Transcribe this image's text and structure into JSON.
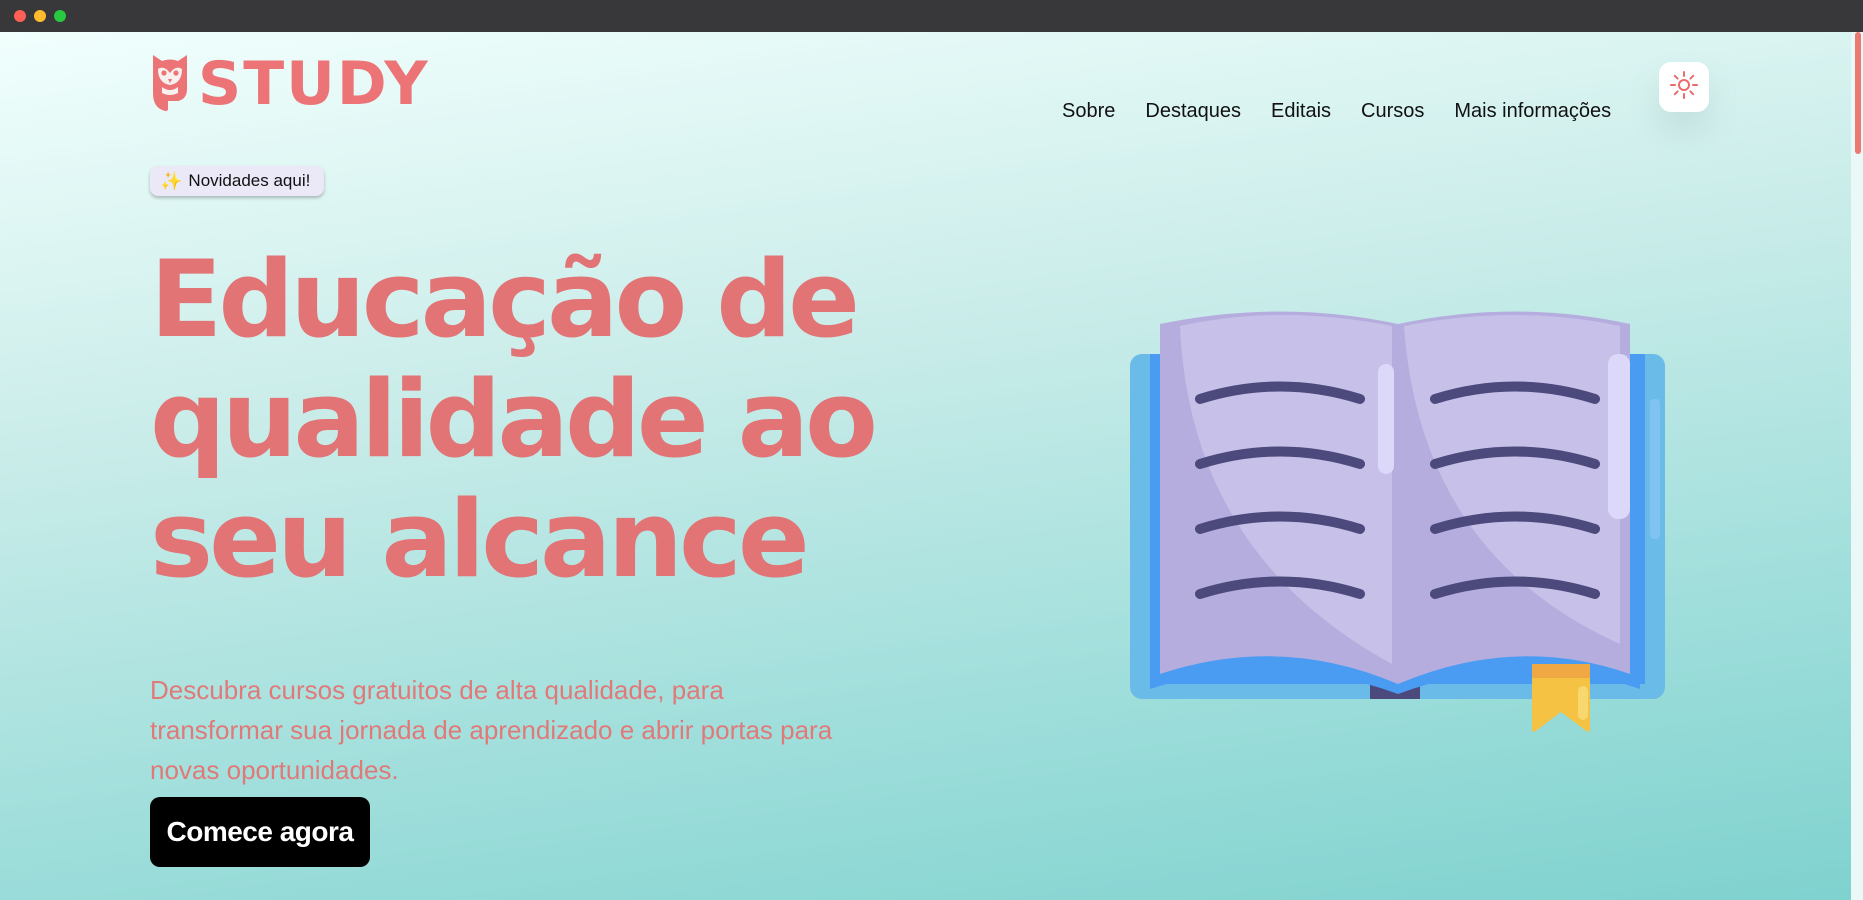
{
  "brand": {
    "name": "STUDY",
    "accent": "#ec7476"
  },
  "nav": {
    "items": [
      {
        "label": "Sobre"
      },
      {
        "label": "Destaques"
      },
      {
        "label": "Editais"
      },
      {
        "label": "Cursos"
      },
      {
        "label": "Mais informações"
      }
    ],
    "theme_toggle_icon": "sun-icon"
  },
  "hero": {
    "badge": {
      "icon": "sparkles-icon",
      "label": "Novidades aqui!"
    },
    "title_lines": [
      "Educação de",
      "qualidade ao",
      "seu alcance"
    ],
    "subtitle": "Descubra cursos gratuitos de alta qualidade, para transformar sua jornada de aprendizado e abrir portas para novas oportunidades.",
    "cta_label": "Comece agora",
    "illustration": "open-book-icon"
  }
}
